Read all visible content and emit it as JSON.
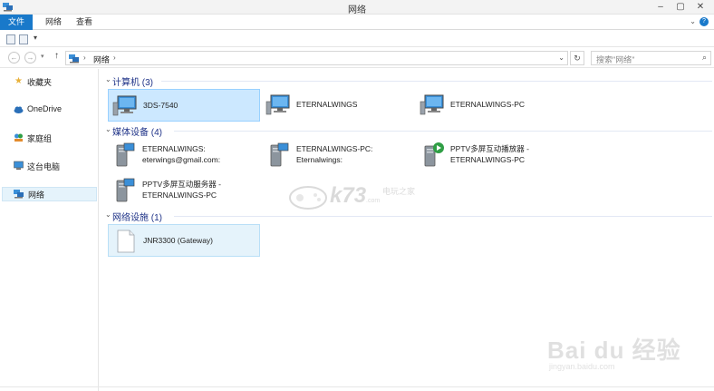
{
  "window": {
    "title": "网络"
  },
  "ribbon": {
    "tabs": [
      {
        "label": "文件",
        "active": true
      },
      {
        "label": "网络",
        "active": false
      },
      {
        "label": "查看",
        "active": false
      }
    ]
  },
  "address_bar": {
    "path": [
      "网络"
    ],
    "search_placeholder": "搜索\"网络\""
  },
  "sidebar": {
    "items": [
      {
        "label": "收藏夹",
        "icon": "star-icon",
        "selected": false
      },
      {
        "label": "OneDrive",
        "icon": "cloud-icon",
        "selected": false
      },
      {
        "label": "家庭组",
        "icon": "homegroup-icon",
        "selected": false
      },
      {
        "label": "这台电脑",
        "icon": "computer-icon",
        "selected": false
      },
      {
        "label": "网络",
        "icon": "network-icon",
        "selected": true
      }
    ]
  },
  "groups": [
    {
      "header": "计算机 (3)",
      "items": [
        {
          "lines": [
            "3DS-7540"
          ],
          "icon": "computer-monitor-icon",
          "state": "selected"
        },
        {
          "lines": [
            "ETERNALWINGS"
          ],
          "icon": "computer-monitor-icon",
          "state": "normal"
        },
        {
          "lines": [
            "ETERNALWINGS-PC"
          ],
          "icon": "computer-monitor-icon",
          "state": "normal"
        }
      ]
    },
    {
      "header": "媒体设备 (4)",
      "items": [
        {
          "lines": [
            "ETERNALWINGS:",
            "eterwings@gmail.com:"
          ],
          "icon": "media-server-icon",
          "state": "normal"
        },
        {
          "lines": [
            "ETERNALWINGS-PC:",
            "Eternalwings:"
          ],
          "icon": "media-server-icon",
          "state": "normal"
        },
        {
          "lines": [
            "PPTV多屏互动播放器 -",
            "ETERNALWINGS-PC"
          ],
          "icon": "media-player-icon",
          "state": "normal"
        },
        {
          "lines": [
            "PPTV多屏互动服务器 -",
            "ETERNALWINGS-PC"
          ],
          "icon": "media-server-icon",
          "state": "normal"
        }
      ]
    },
    {
      "header": "网络设施 (1)",
      "items": [
        {
          "lines": [
            "JNR3300 (Gateway)"
          ],
          "icon": "blank-document-icon",
          "state": "hover"
        }
      ]
    }
  ],
  "watermarks": {
    "k73_text": "k73",
    "k73_sub": "电玩之家",
    "k73_url": ".com",
    "baidu_logo": "Bai du 经验",
    "baidu_url": "jingyan.baidu.com"
  }
}
